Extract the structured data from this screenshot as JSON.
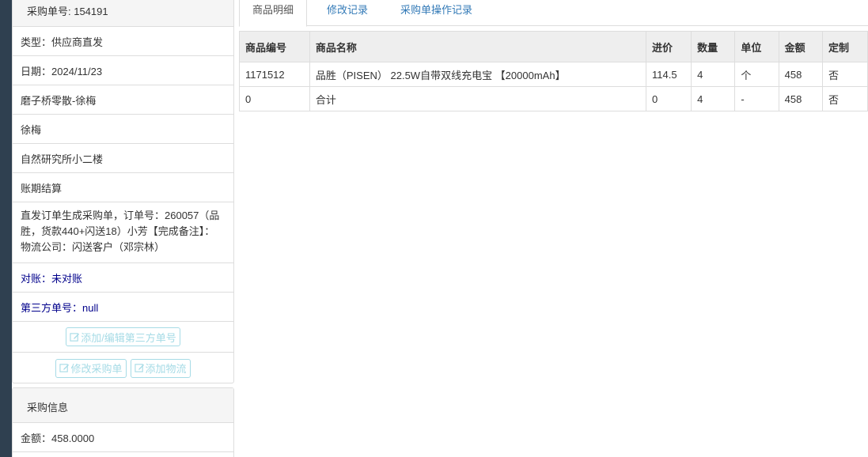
{
  "order": {
    "heading": "采购单号: 154191",
    "items": [
      "类型：供应商直发",
      "日期：2024/11/23",
      "磨子桥零散-徐梅",
      "徐梅",
      "自然研究所小二楼",
      "账期结算",
      "直发订单生成采购单，订单号：260057（品胜，货款440+闪送18）小芳【完成备注】： 物流公司：闪送客户（邓宗林）"
    ],
    "reconcile": "对账：未对账",
    "third_party_no": "第三方单号：null",
    "buttons": {
      "edit_third_party": "添加/编辑第三方单号",
      "edit_order": "修改采购单",
      "add_logistics": "添加物流"
    }
  },
  "purchase_info": {
    "heading": "采购信息",
    "amount": "金额：458.0000"
  },
  "tabs": [
    "商品明细",
    "修改记录",
    "采购单操作记录"
  ],
  "table": {
    "headers": [
      "商品编号",
      "商品名称",
      "进价",
      "数量",
      "单位",
      "金额",
      "定制"
    ],
    "rows": [
      [
        "1171512",
        "品胜（PISEN） 22.5W自带双线充电宝 【20000mAh】",
        "114.5",
        "4",
        "个",
        "458",
        "否"
      ],
      [
        "0",
        "合计",
        "0",
        "4",
        "-",
        "458",
        "否"
      ]
    ]
  },
  "colors": {
    "sidebar_dark": "#2f4050",
    "link_blue": "#337ab7",
    "dark_blue_text": "#00008b",
    "button_border": "#a6dbe6"
  }
}
